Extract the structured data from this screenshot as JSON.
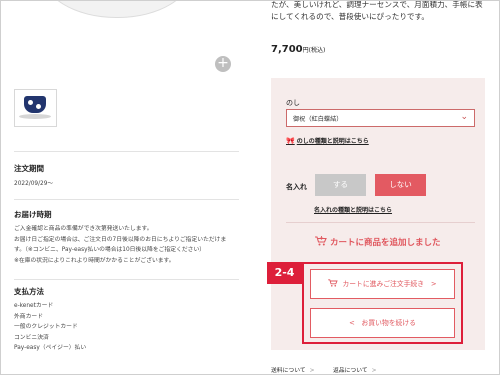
{
  "product": {
    "description_line1": "たが、美しいけれど、調理ナーセンスで、月面積力、手帳に表",
    "description_line2": "にしてくれるので、普段使いにぴったりです。",
    "price_value": "7,700",
    "price_unit": "円(税込)"
  },
  "gallery": {
    "zoom_symbol": "+"
  },
  "order_period": {
    "heading": "注文期間",
    "value": "2022/09/29〜"
  },
  "delivery": {
    "heading": "お届け時期",
    "lines": [
      "ご入金確認と商品の準備ができ次第発送いたします。",
      "お届け日ご指定の場合は、ご注文日の7日後以降のお日にちよりご指定いただけま",
      "す。（※コンビニ、Pay-easy払いの場合は10日後以降をご指定ください）",
      "※在庫の状況によりこれより時間がかかることがございます。"
    ]
  },
  "payment": {
    "heading": "支払方法",
    "items": [
      "e-kenetカード",
      "外商カード",
      "一般のクレジットカード",
      "コンビニ決済",
      "Pay-easy（ペイジー）払い"
    ]
  },
  "noshi": {
    "label": "のし",
    "selected": "御祝（紅白蝶結）",
    "chevron": "⌄",
    "link_icon": "🎀",
    "link_text": "のしの種類と説明はこちら"
  },
  "naire": {
    "label": "名入れ",
    "option_yes": "する",
    "option_no": "しない",
    "link_text": "名入れの種類と説明はこちら"
  },
  "cart": {
    "added_message": "カートに商品を追加しました",
    "checkout_button": "カートに進みご注文手続き　>",
    "continue_button": "<　お買い物を続ける"
  },
  "annotation": {
    "badge": "2-4",
    "color": "#dd1f3a"
  },
  "footer_links": [
    {
      "label": "送料について",
      "arrow": ">"
    },
    {
      "label": "返品について",
      "arrow": ">"
    }
  ],
  "colors": {
    "accent": "#e0565d",
    "panel_bg": "#f6eceb",
    "toggle_off": "#c8c8c8",
    "toggle_on": "#e35a62"
  }
}
